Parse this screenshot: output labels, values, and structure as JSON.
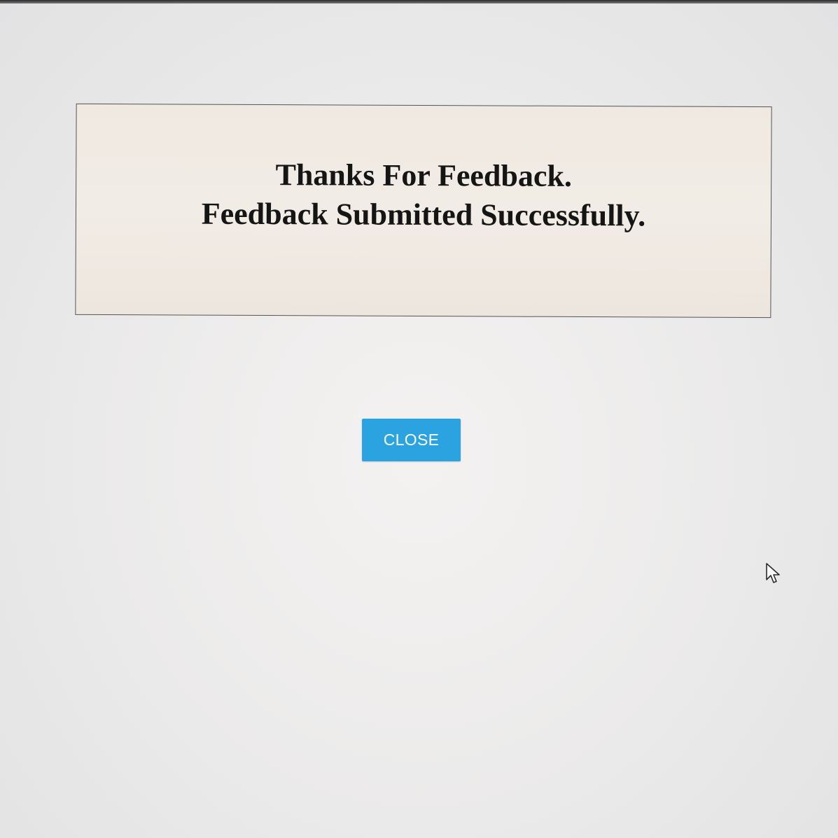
{
  "dialog": {
    "line1": "Thanks For Feedback.",
    "line2": "Feedback Submitted Successfully."
  },
  "actions": {
    "close_label": "CLOSE"
  },
  "colors": {
    "button_bg": "#2aa3e0",
    "button_text": "#ffffff",
    "message_bg": "#efe9e1",
    "message_text": "#151515"
  },
  "icons": {
    "pointer": "mouse-pointer-icon"
  }
}
